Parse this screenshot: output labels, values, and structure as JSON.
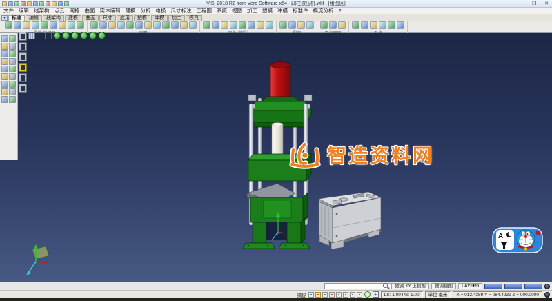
{
  "window": {
    "title": "VISI 2018 R2 from Vero Software x64 - 四柱液压机.wkf - [绘图区]",
    "controls": {
      "minimize": "—",
      "restore": "❐",
      "close": "✕"
    }
  },
  "menubar": {
    "items": [
      "文件",
      "编辑",
      "线架构",
      "点云",
      "网格",
      "曲面",
      "实体编辑",
      "建模",
      "分析",
      "电极",
      "尺寸标注",
      "工程图",
      "系统",
      "视图",
      "加工",
      "塑模",
      "冲模",
      "标准件",
      "模流分析",
      "?"
    ]
  },
  "tabs": {
    "items": [
      "标准",
      "编辑",
      "线架构",
      "建模",
      "曲面",
      "尺寸",
      "应用",
      "塑模",
      "冲模",
      "加工",
      "模具"
    ]
  },
  "toolbar": {
    "groups": [
      "属性/过滤器",
      "图形",
      "图像 (捕捉)",
      "视图",
      "工作平面",
      "系统"
    ]
  },
  "viewport": {
    "watermark": "智造资料网"
  },
  "statusbar": {
    "hint_view": "微调 XY 上视图",
    "hint_view2": "微调视图",
    "layer": "LAYER0",
    "snap": "捕捉",
    "scale": "LS: 1.00 PS: 1.00",
    "units": "单位 毫米",
    "coords": "X = 012.4389 Y = 084.4239 Z = 000.0000",
    "cross": "+"
  },
  "sticker": {
    "letter": "A"
  },
  "colors": {
    "accent_orange": "#ef8220",
    "press_green": "#1b7e1b",
    "cylinder_red": "#c01010",
    "machine_gray": "#cdd1d5",
    "viewport_top": "#1c2746",
    "viewport_bottom": "#475983"
  }
}
